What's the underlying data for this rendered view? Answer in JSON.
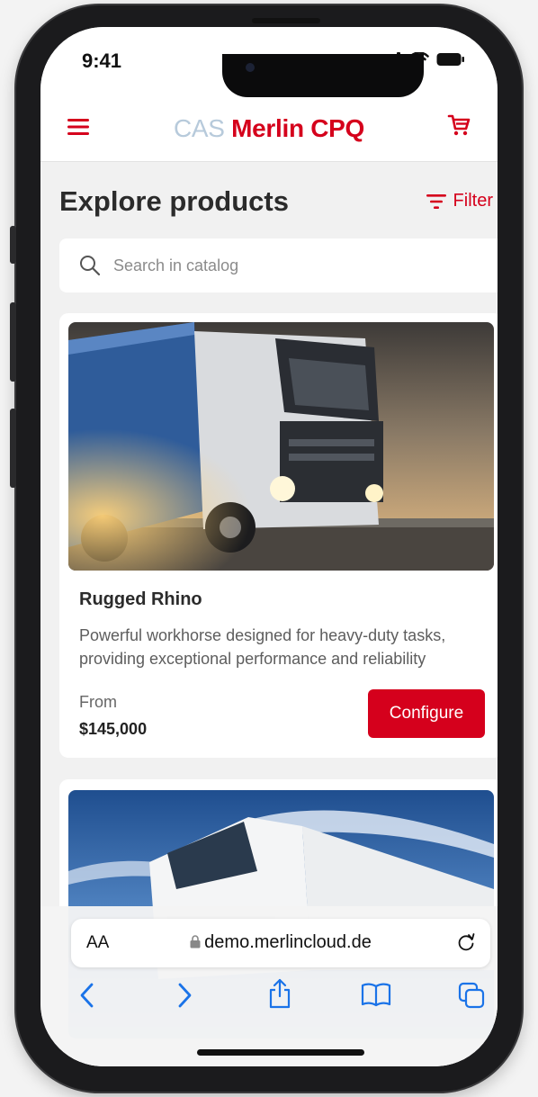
{
  "status_bar": {
    "time": "9:41"
  },
  "app_header": {
    "brand_prefix": "CAS",
    "brand_name": "Merlin CPQ"
  },
  "page": {
    "title": "Explore products",
    "filter_label": "Filter"
  },
  "search": {
    "placeholder": "Search in catalog"
  },
  "products": [
    {
      "name": "Rugged Rhino",
      "description": "Powerful workhorse designed for heavy-duty tasks, providing exceptional performance and reliability",
      "price_prefix": "From",
      "price": "$145,000",
      "button_label": "Configure"
    }
  ],
  "browser": {
    "text_size_label": "AA",
    "domain": "demo.merlincloud.de"
  },
  "colors": {
    "accent": "#d5001c",
    "brand_light": "#b7cadb",
    "background": "#f1f1f1"
  },
  "icons": [
    "menu-icon",
    "cart-icon",
    "filter-icon",
    "search-icon",
    "lock-icon",
    "reload-icon",
    "back-icon",
    "forward-icon",
    "share-icon",
    "bookmarks-icon",
    "tabs-icon"
  ]
}
